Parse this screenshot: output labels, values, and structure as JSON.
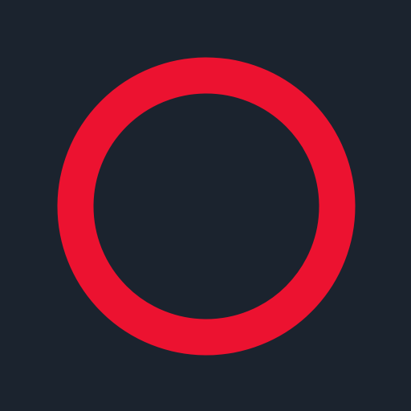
{
  "icon": {
    "name": "red-ring-icon",
    "shape": "ring",
    "colors": {
      "background": "#1b232e",
      "ring": "#ec1230"
    }
  }
}
